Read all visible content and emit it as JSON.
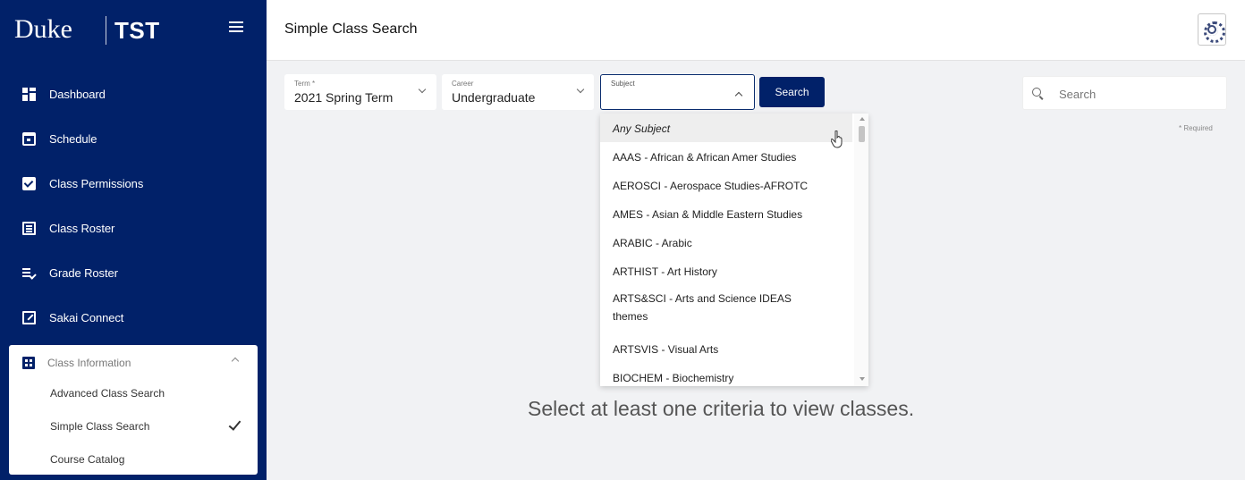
{
  "brand": {
    "logo": "Duke",
    "app": "TST"
  },
  "sidebar": {
    "items": [
      {
        "label": "Dashboard",
        "icon": "dashboard-icon"
      },
      {
        "label": "Schedule",
        "icon": "calendar-icon"
      },
      {
        "label": "Class Permissions",
        "icon": "checkbox-icon"
      },
      {
        "label": "Class Roster",
        "icon": "roster-icon"
      },
      {
        "label": "Grade Roster",
        "icon": "grade-roster-icon"
      },
      {
        "label": "Sakai Connect",
        "icon": "edit-icon"
      }
    ],
    "group": {
      "label": "Class Information",
      "icon": "class-info-icon",
      "children": [
        {
          "label": "Advanced Class Search"
        },
        {
          "label": "Simple Class Search",
          "selected": true
        },
        {
          "label": "Course Catalog"
        }
      ]
    }
  },
  "header": {
    "title": "Simple Class Search"
  },
  "filters": {
    "term": {
      "label": "Term *",
      "value": "2021 Spring Term"
    },
    "career": {
      "label": "Career",
      "value": "Undergraduate"
    },
    "subject": {
      "label": "Subject",
      "value": ""
    },
    "search_button": "Search",
    "search_placeholder": "Search",
    "required_note": "* Required"
  },
  "dropdown": {
    "options": [
      "Any Subject",
      "AAAS - African & African Amer Studies",
      "AEROSCI - Aerospace Studies-AFROTC",
      "AMES - Asian & Middle Eastern Studies",
      "ARABIC - Arabic",
      "ARTHIST - Art History",
      "ARTS&SCI - Arts and Science IDEAS themes",
      "ARTSVIS - Visual Arts",
      "BIOCHEM - Biochemistry"
    ]
  },
  "main": {
    "empty_message": "Select at least one criteria to view classes."
  },
  "colors": {
    "brand_navy": "#012169",
    "background": "#f1f2f4"
  }
}
